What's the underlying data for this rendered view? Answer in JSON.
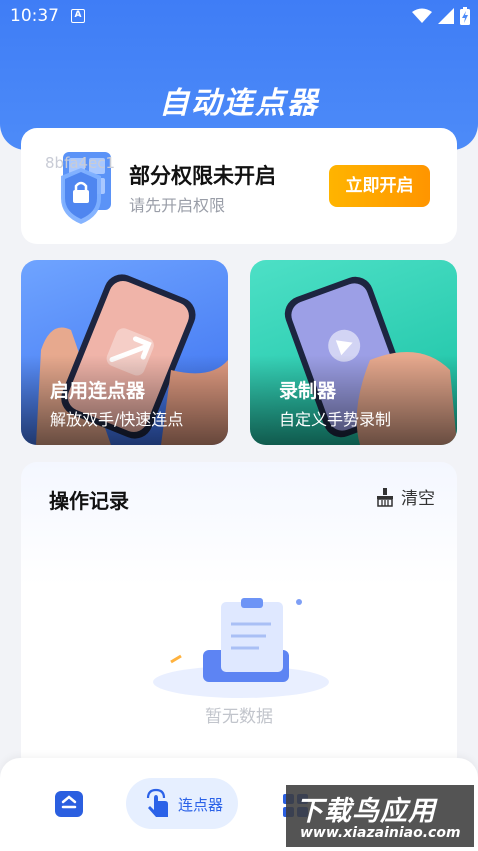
{
  "status_bar": {
    "time": "10:37",
    "notification_icon": "a-icon",
    "icons": [
      "wifi-icon",
      "signal-icon",
      "battery-charging-icon"
    ]
  },
  "app": {
    "title": "自动连点器"
  },
  "permission": {
    "overlay_text": "8bfa4ec1",
    "title": "部分权限未开启",
    "subtitle": "请先开启权限",
    "button": "立即开启"
  },
  "features": [
    {
      "title": "启用连点器",
      "subtitle": "解放双手/快速连点"
    },
    {
      "title": "录制器",
      "subtitle": "自定义手势录制"
    }
  ],
  "log": {
    "title": "操作记录",
    "clear_label": "清空",
    "empty_text": "暂无数据"
  },
  "nav": {
    "items": [
      {
        "icon": "home-icon",
        "label": ""
      },
      {
        "icon": "tap-icon",
        "label": "连点器"
      },
      {
        "icon": "grid-icon",
        "label": ""
      }
    ]
  },
  "watermark": {
    "main": "下载鸟应用",
    "url": "www.xiazainiao.com"
  },
  "colors": {
    "primary_blue": "#3f7df6",
    "orange_button": "#ffa500",
    "teal_card": "#17c0a3"
  }
}
